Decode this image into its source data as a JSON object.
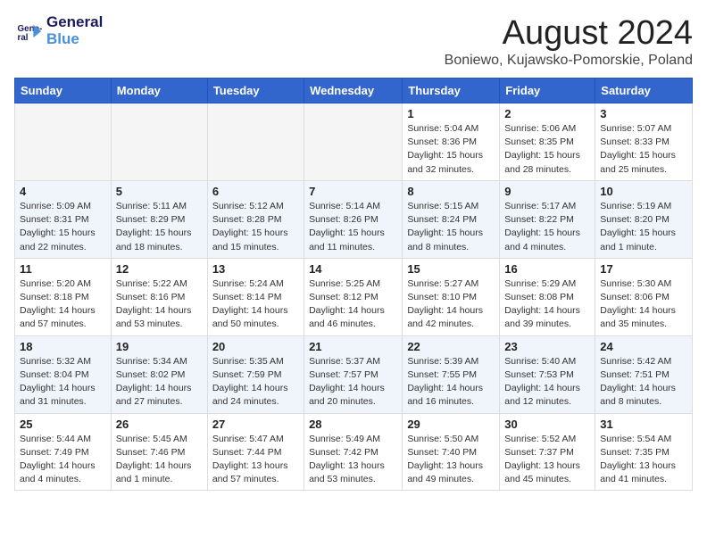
{
  "logo": {
    "line1": "General",
    "line2": "Blue"
  },
  "title": "August 2024",
  "location": "Boniewo, Kujawsko-Pomorskie, Poland",
  "headers": [
    "Sunday",
    "Monday",
    "Tuesday",
    "Wednesday",
    "Thursday",
    "Friday",
    "Saturday"
  ],
  "weeks": [
    [
      {
        "num": "",
        "info": ""
      },
      {
        "num": "",
        "info": ""
      },
      {
        "num": "",
        "info": ""
      },
      {
        "num": "",
        "info": ""
      },
      {
        "num": "1",
        "info": "Sunrise: 5:04 AM\nSunset: 8:36 PM\nDaylight: 15 hours\nand 32 minutes."
      },
      {
        "num": "2",
        "info": "Sunrise: 5:06 AM\nSunset: 8:35 PM\nDaylight: 15 hours\nand 28 minutes."
      },
      {
        "num": "3",
        "info": "Sunrise: 5:07 AM\nSunset: 8:33 PM\nDaylight: 15 hours\nand 25 minutes."
      }
    ],
    [
      {
        "num": "4",
        "info": "Sunrise: 5:09 AM\nSunset: 8:31 PM\nDaylight: 15 hours\nand 22 minutes."
      },
      {
        "num": "5",
        "info": "Sunrise: 5:11 AM\nSunset: 8:29 PM\nDaylight: 15 hours\nand 18 minutes."
      },
      {
        "num": "6",
        "info": "Sunrise: 5:12 AM\nSunset: 8:28 PM\nDaylight: 15 hours\nand 15 minutes."
      },
      {
        "num": "7",
        "info": "Sunrise: 5:14 AM\nSunset: 8:26 PM\nDaylight: 15 hours\nand 11 minutes."
      },
      {
        "num": "8",
        "info": "Sunrise: 5:15 AM\nSunset: 8:24 PM\nDaylight: 15 hours\nand 8 minutes."
      },
      {
        "num": "9",
        "info": "Sunrise: 5:17 AM\nSunset: 8:22 PM\nDaylight: 15 hours\nand 4 minutes."
      },
      {
        "num": "10",
        "info": "Sunrise: 5:19 AM\nSunset: 8:20 PM\nDaylight: 15 hours\nand 1 minute."
      }
    ],
    [
      {
        "num": "11",
        "info": "Sunrise: 5:20 AM\nSunset: 8:18 PM\nDaylight: 14 hours\nand 57 minutes."
      },
      {
        "num": "12",
        "info": "Sunrise: 5:22 AM\nSunset: 8:16 PM\nDaylight: 14 hours\nand 53 minutes."
      },
      {
        "num": "13",
        "info": "Sunrise: 5:24 AM\nSunset: 8:14 PM\nDaylight: 14 hours\nand 50 minutes."
      },
      {
        "num": "14",
        "info": "Sunrise: 5:25 AM\nSunset: 8:12 PM\nDaylight: 14 hours\nand 46 minutes."
      },
      {
        "num": "15",
        "info": "Sunrise: 5:27 AM\nSunset: 8:10 PM\nDaylight: 14 hours\nand 42 minutes."
      },
      {
        "num": "16",
        "info": "Sunrise: 5:29 AM\nSunset: 8:08 PM\nDaylight: 14 hours\nand 39 minutes."
      },
      {
        "num": "17",
        "info": "Sunrise: 5:30 AM\nSunset: 8:06 PM\nDaylight: 14 hours\nand 35 minutes."
      }
    ],
    [
      {
        "num": "18",
        "info": "Sunrise: 5:32 AM\nSunset: 8:04 PM\nDaylight: 14 hours\nand 31 minutes."
      },
      {
        "num": "19",
        "info": "Sunrise: 5:34 AM\nSunset: 8:02 PM\nDaylight: 14 hours\nand 27 minutes."
      },
      {
        "num": "20",
        "info": "Sunrise: 5:35 AM\nSunset: 7:59 PM\nDaylight: 14 hours\nand 24 minutes."
      },
      {
        "num": "21",
        "info": "Sunrise: 5:37 AM\nSunset: 7:57 PM\nDaylight: 14 hours\nand 20 minutes."
      },
      {
        "num": "22",
        "info": "Sunrise: 5:39 AM\nSunset: 7:55 PM\nDaylight: 14 hours\nand 16 minutes."
      },
      {
        "num": "23",
        "info": "Sunrise: 5:40 AM\nSunset: 7:53 PM\nDaylight: 14 hours\nand 12 minutes."
      },
      {
        "num": "24",
        "info": "Sunrise: 5:42 AM\nSunset: 7:51 PM\nDaylight: 14 hours\nand 8 minutes."
      }
    ],
    [
      {
        "num": "25",
        "info": "Sunrise: 5:44 AM\nSunset: 7:49 PM\nDaylight: 14 hours\nand 4 minutes."
      },
      {
        "num": "26",
        "info": "Sunrise: 5:45 AM\nSunset: 7:46 PM\nDaylight: 14 hours\nand 1 minute."
      },
      {
        "num": "27",
        "info": "Sunrise: 5:47 AM\nSunset: 7:44 PM\nDaylight: 13 hours\nand 57 minutes."
      },
      {
        "num": "28",
        "info": "Sunrise: 5:49 AM\nSunset: 7:42 PM\nDaylight: 13 hours\nand 53 minutes."
      },
      {
        "num": "29",
        "info": "Sunrise: 5:50 AM\nSunset: 7:40 PM\nDaylight: 13 hours\nand 49 minutes."
      },
      {
        "num": "30",
        "info": "Sunrise: 5:52 AM\nSunset: 7:37 PM\nDaylight: 13 hours\nand 45 minutes."
      },
      {
        "num": "31",
        "info": "Sunrise: 5:54 AM\nSunset: 7:35 PM\nDaylight: 13 hours\nand 41 minutes."
      }
    ]
  ]
}
